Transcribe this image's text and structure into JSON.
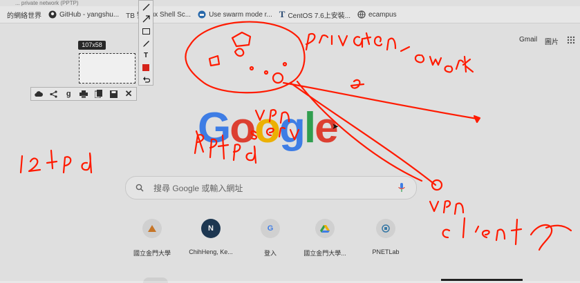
{
  "address_bar": {
    "fragment": "... private network (PPTP)"
  },
  "bookmarks": [
    {
      "label": "的網絡世界",
      "icon": "page-icon"
    },
    {
      "label": "GitHub - yangshu...",
      "icon": "github-icon"
    },
    {
      "label": "TB 警",
      "icon": "page-icon"
    },
    {
      "label": "ux Shell Sc...",
      "icon": "page-icon"
    },
    {
      "label": "Use swarm mode r...",
      "icon": "docker-icon"
    },
    {
      "label": "CentOS 7.6上安裝...",
      "icon": "text-t-icon"
    },
    {
      "label": "ecampus",
      "icon": "globe-icon"
    }
  ],
  "header": {
    "gmail": "Gmail",
    "images": "圖片"
  },
  "logo": {
    "letters": [
      "G",
      "o",
      "o",
      "g",
      "l",
      "e"
    ],
    "colors": [
      "#4285f4",
      "#ea4335",
      "#fbbc05",
      "#4285f4",
      "#34a853",
      "#ea4335"
    ]
  },
  "search": {
    "placeholder": "搜尋 Google 或輸入網址"
  },
  "shortcuts": [
    {
      "label": "國立金門大學",
      "glyph": "",
      "color": "#d37d2a"
    },
    {
      "label": "ChihHeng, Ke...",
      "glyph": "N",
      "color": "#1f3b57"
    },
    {
      "label": "登入",
      "glyph": "G",
      "color": "#4285f4"
    },
    {
      "label": "國立金門大學...",
      "glyph": "",
      "color": "#34a853"
    },
    {
      "label": "PNETLab",
      "glyph": "",
      "color": "#3a7fb0"
    }
  ],
  "snip": {
    "size": "107x58"
  },
  "annotations": {
    "text1": "private network",
    "text2": "vpn server",
    "text3": "vpn client",
    "text4": "pptpd",
    "text5": "l2tpd",
    "color": "#ff1a00"
  }
}
